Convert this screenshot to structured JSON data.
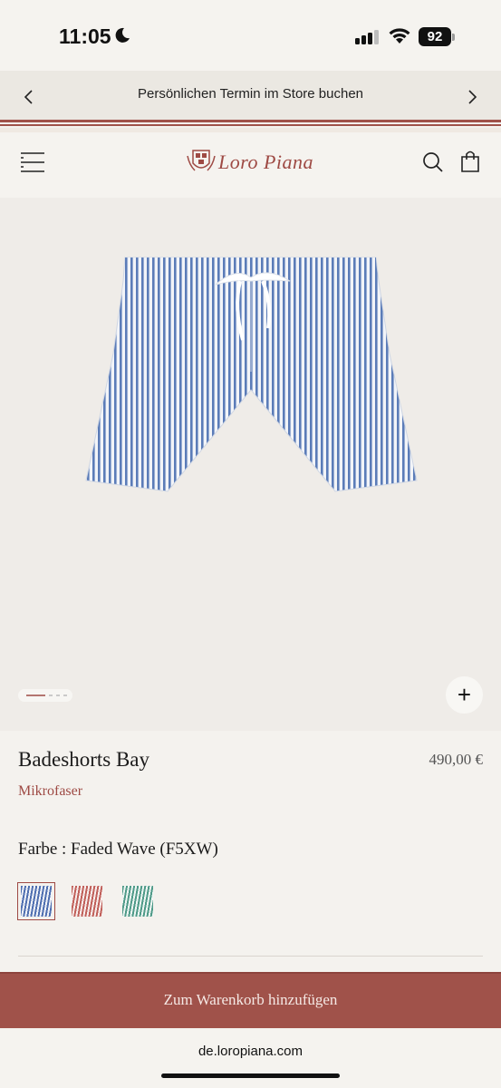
{
  "status_bar": {
    "time": "11:05",
    "battery": "92",
    "icons": [
      "moon-icon",
      "signal-icon",
      "wifi-icon",
      "battery-icon"
    ]
  },
  "promo": {
    "text": "Persönlichen Termin im Store buchen",
    "prev_icon": "chevron-left-icon",
    "next_icon": "chevron-right-icon"
  },
  "header": {
    "logo_text": "Loro Piana",
    "menu_icon": "menu-icon",
    "search_icon": "search-icon",
    "bag_icon": "shopping-bag-icon"
  },
  "gallery": {
    "zoom_label": "+",
    "image": "blue-striped-swim-shorts"
  },
  "product": {
    "title": "Badeshorts Bay",
    "price": "490,00 €",
    "material": "Mikrofaser",
    "color_label": "Farbe : Faded Wave (F5XW)",
    "swatches": [
      {
        "name": "blue-stripe",
        "color": "#4f6fb0",
        "selected": true
      },
      {
        "name": "red-stripe",
        "color": "#c0605a",
        "selected": false
      },
      {
        "name": "green-stripe",
        "color": "#4f9a88",
        "selected": false
      }
    ]
  },
  "cart": {
    "button_label": "Zum Warenkorb hinzufügen"
  },
  "browser": {
    "url": "de.loropiana.com"
  },
  "colors": {
    "brand": "#9e4a44",
    "cart_button": "#a0524a",
    "background": "#f4f2ee"
  }
}
